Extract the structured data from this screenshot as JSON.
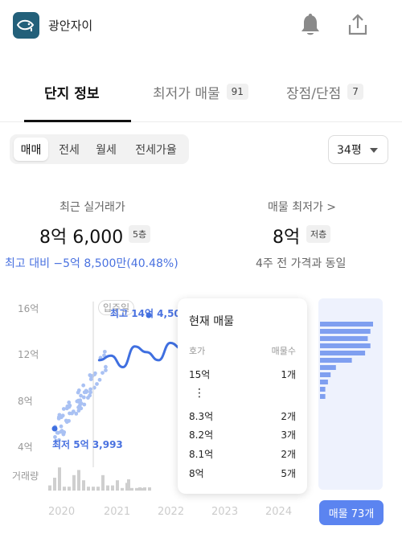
{
  "app": {
    "title": "광안자이",
    "accent": "#23607a"
  },
  "header": {
    "bell_icon": "bell-icon",
    "share_icon": "share-icon"
  },
  "tabs": [
    {
      "label": "단지 정보",
      "badge": ""
    },
    {
      "label": "최저가 매물",
      "badge": "91"
    },
    {
      "label": "장점/단점",
      "badge": "7"
    }
  ],
  "deal_types": [
    "매매",
    "전세",
    "월세",
    "전세가율"
  ],
  "size_select": {
    "value": "34평"
  },
  "recent_trade": {
    "label": "최근 실거래가",
    "value": "8억 6,000",
    "floor": "5층",
    "compare": "최고 대비 −5억 8,500만(40.48%)"
  },
  "lowest_listing": {
    "label": "매물 최저가 >",
    "value": "8억",
    "floor": "저층",
    "compare": "4주 전 가격과 동일"
  },
  "chart": {
    "y_ticks": [
      "16억",
      "12억",
      "8억",
      "4억"
    ],
    "volume_label": "거래량",
    "x_ticks": [
      "2020",
      "2021",
      "2022",
      "2023",
      "2024"
    ],
    "move_in_label": "입주일",
    "max_label": "최고 14억 4,50",
    "min_label": "최저 5억 3,993",
    "colors": {
      "line": "#3f6fe0",
      "dots": "#a9c1f3",
      "volume": "#cfcfcf",
      "listing_bars": "#7f9ff0"
    }
  },
  "chart_data": {
    "type": "line",
    "title": "",
    "ylabel": "",
    "ylim": [
      4,
      16
    ],
    "x_range": [
      2020,
      2024.5
    ],
    "series": [
      {
        "x": [
          2020.75,
          2020.95,
          2021.15,
          2021.35,
          2021.55,
          2021.75,
          2021.95,
          2022.15
        ],
        "y": [
          11.4,
          11.8,
          10.8,
          12.6,
          12.1,
          11.4,
          12.9,
          12.4
        ]
      }
    ],
    "listing_histogram": {
      "price_range": [
        8,
        15
      ],
      "bars": [
        0.1,
        0.1,
        0.15,
        0.2,
        0.3,
        0.6,
        0.85,
        0.95,
        0.9,
        0.95,
        1.0
      ]
    }
  },
  "listing_popup": {
    "title": "현재 매물",
    "col_unit": "호가",
    "col_count": "매물수",
    "rows": [
      {
        "price": "15억",
        "count": "1개"
      },
      {
        "price": "8.3억",
        "count": "2개"
      },
      {
        "price": "8.2억",
        "count": "3개"
      },
      {
        "price": "8.1억",
        "count": "2개"
      },
      {
        "price": "8억",
        "count": "5개"
      }
    ],
    "ellipsis": "⋮"
  },
  "listing_button": {
    "label": "매물 73개"
  }
}
